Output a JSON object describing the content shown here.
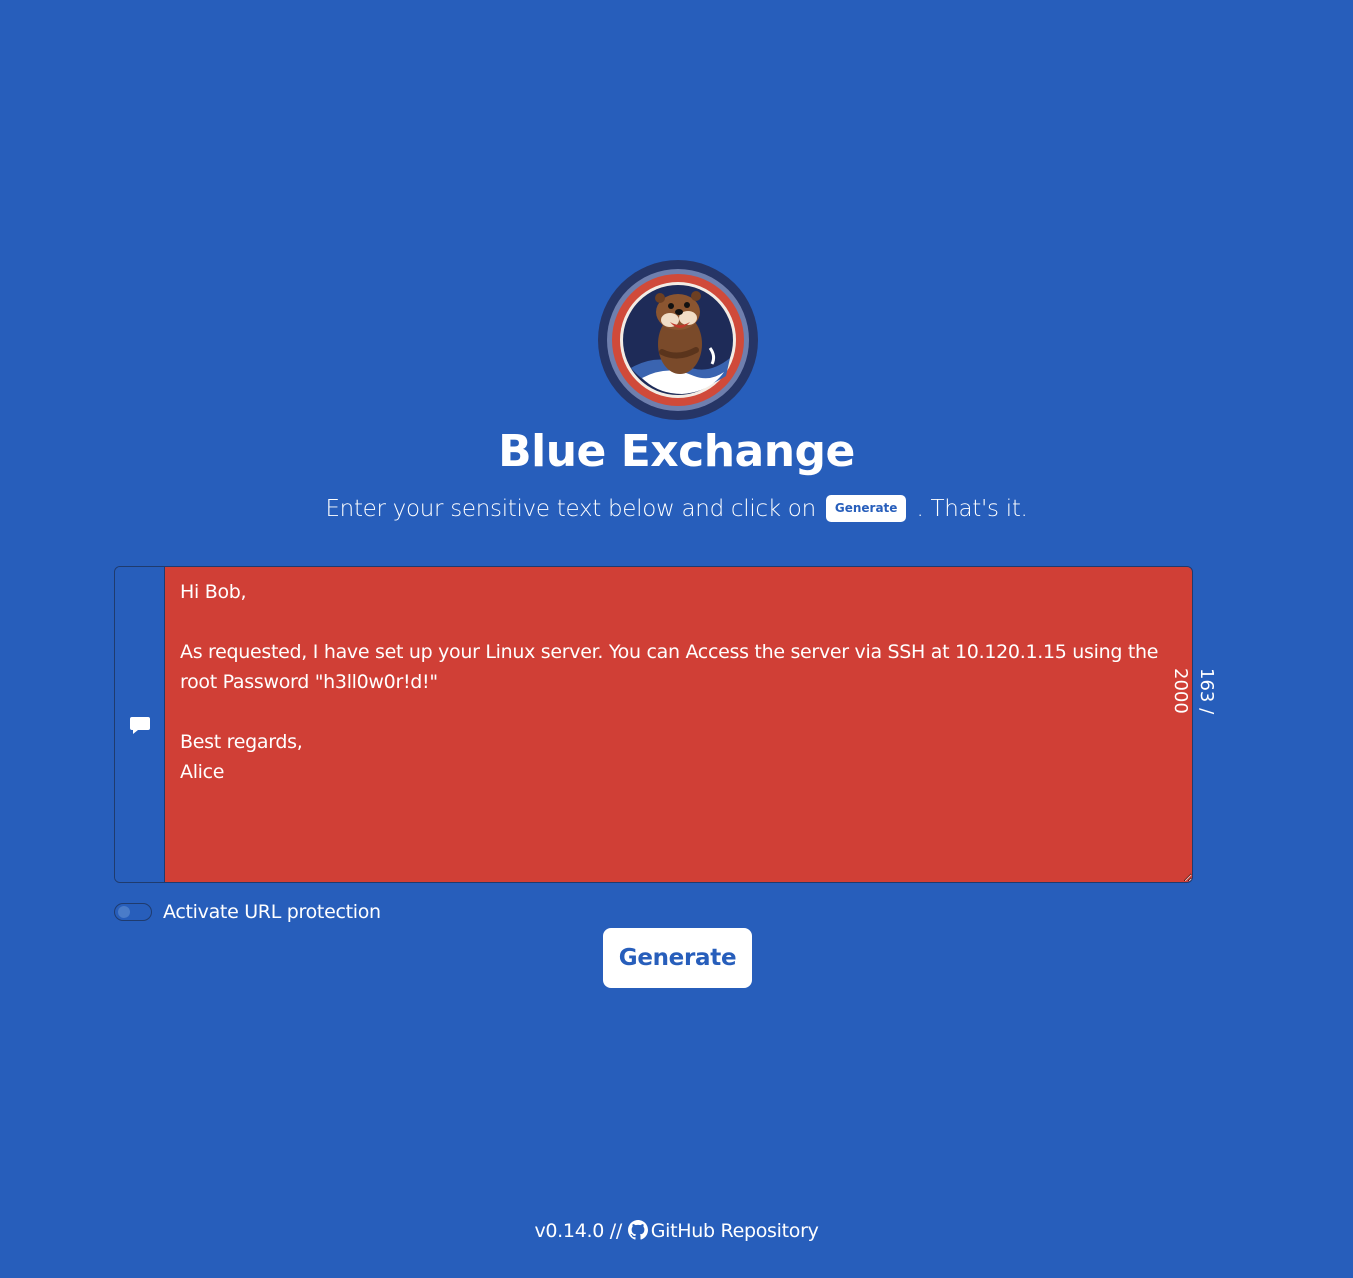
{
  "app": {
    "title": "Blue Exchange"
  },
  "intro": {
    "before": "Enter your sensitive text below and click on",
    "button_label": "Generate",
    "after": ". That's it."
  },
  "message": {
    "text": "Hi Bob,\n\nAs requested, I have set up your Linux server. You can Access the server via SSH at 10.120.1.15 using the root Password \"h3ll0w0r!d!\"\n\nBest regards,\nAlice",
    "counter": "163 / 2000"
  },
  "options": {
    "url_protection_label": "Activate URL protection",
    "url_protection_enabled": false
  },
  "actions": {
    "generate_label": "Generate"
  },
  "footer": {
    "version": "v0.14.0 //",
    "repo_label": "GitHub Repository"
  },
  "colors": {
    "background": "#275ebb",
    "textarea": "#d03f36",
    "button": "#ffffff",
    "button_text": "#275ebb"
  },
  "icons": {
    "message": "comment-icon",
    "repo": "github-icon",
    "logo": "otter-logo"
  }
}
